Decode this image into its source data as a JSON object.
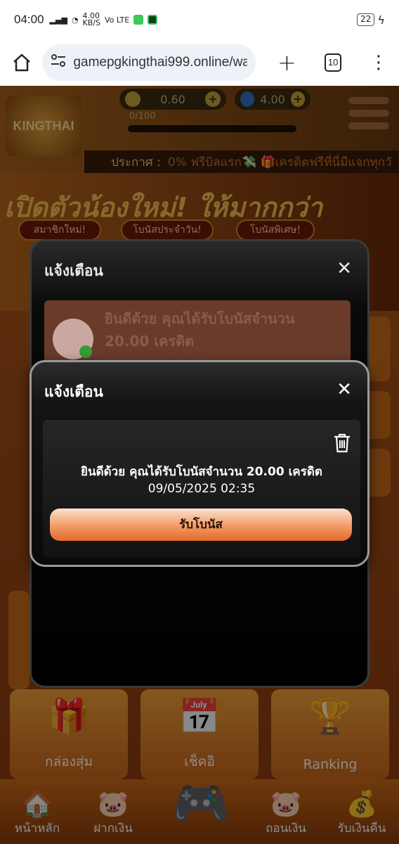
{
  "status_bar": {
    "time": "04:00",
    "net_speed": "4.00",
    "net_unit": "KB/S",
    "volte": "Vo LTE",
    "battery": "22"
  },
  "browser": {
    "url": "gamepgkingthai999.online/wa",
    "tab_count": "10"
  },
  "game": {
    "logo_text": "KINGTHAI 999",
    "coin_balance": "0.60",
    "gem_balance": "4.00",
    "progress_text": "0/100",
    "announce_label": "ประกาศ :",
    "announce_text": "0% ฟรีบิลแรก💸 🎁เครดิตฟรีที่นี่มีแจกทุกวั",
    "banner_title": "เปิดตัวน้องใหม่! ให้มากกว่า",
    "banner_pills": [
      "สมาชิกใหม่!",
      "โบนัสประจำวัน!",
      "โบนัสพิเศษ!"
    ],
    "menu_cards": [
      "กล่องสุ่ม",
      "เช็คอิ",
      "Ranking"
    ],
    "nav_items": [
      "หน้าหลัก",
      "ฝากเงิน",
      "ถอนเงิน",
      "รับเงินคืน"
    ]
  },
  "modal_back": {
    "title": "แจ้งเตือน",
    "message": "ยินดีด้วย คุณได้รับโบนัสจำนวน 20.00 เครดิต",
    "date": "09/05/2025 02:35"
  },
  "modal_front": {
    "title": "แจ้งเตือน",
    "message": "ยินดีด้วย คุณได้รับโบนัสจำนวน 20.00 เครดิต",
    "date": "09/05/2025 02:35",
    "button_label": "รับโบนัส"
  }
}
